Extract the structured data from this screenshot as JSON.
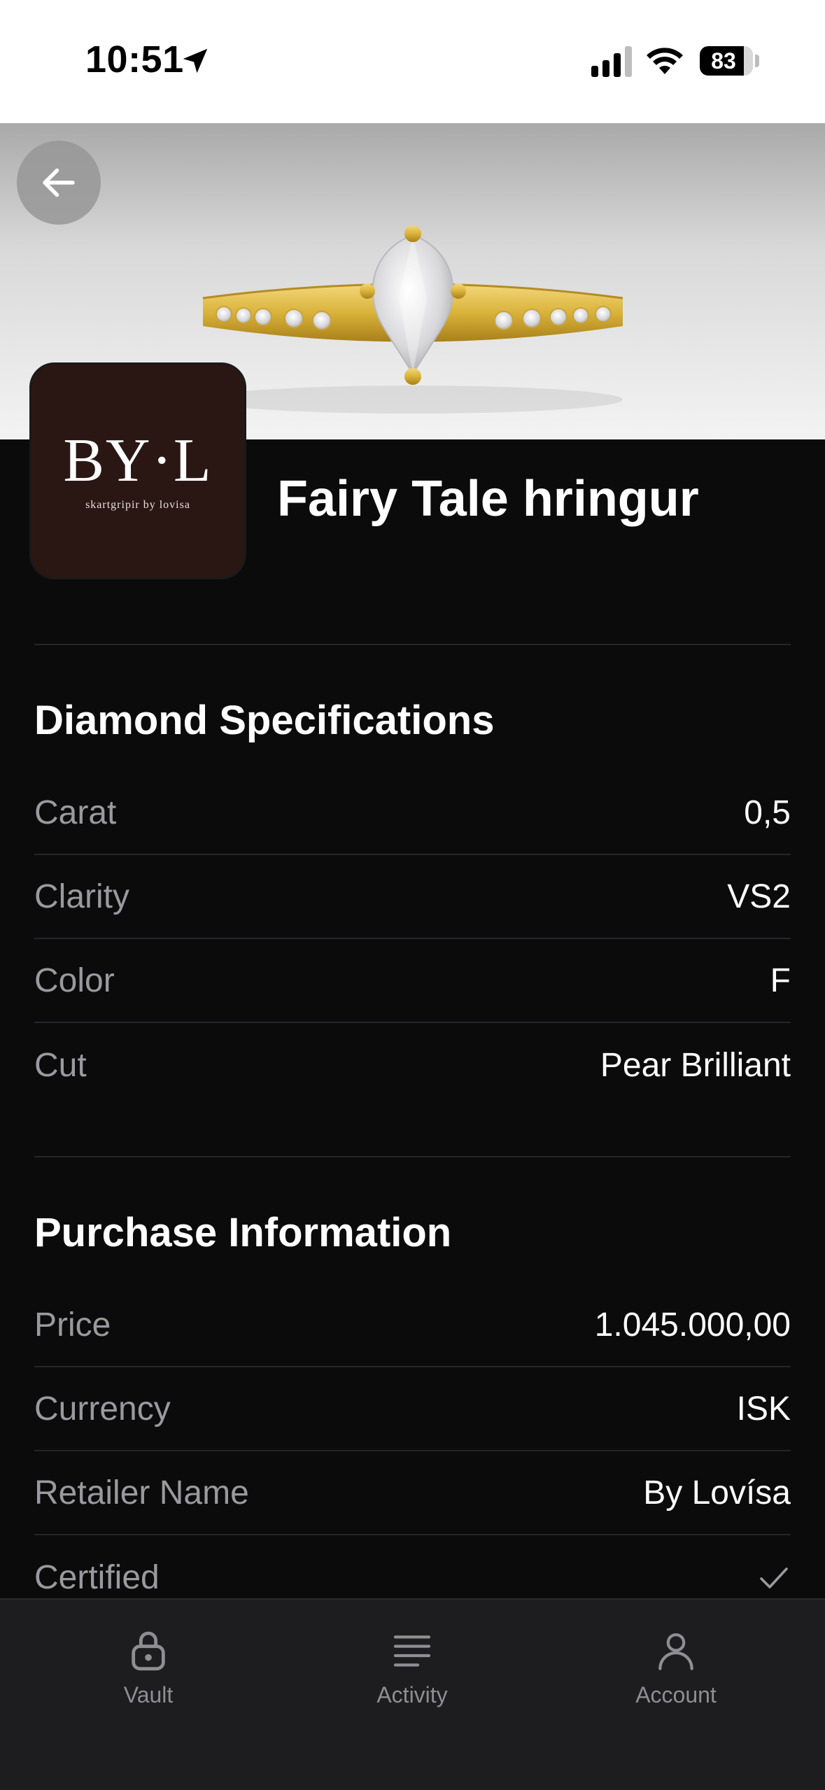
{
  "status_bar": {
    "time": "10:51",
    "battery": "83",
    "battery_level": 0.83
  },
  "product": {
    "title": "Fairy Tale hringur",
    "brand_logo_text": "BY·L",
    "brand_logo_subtitle": "skartgripir by lovisa"
  },
  "diamond_specs": {
    "title": "Diamond Specifications",
    "rows": [
      {
        "label": "Carat",
        "value": "0,5"
      },
      {
        "label": "Clarity",
        "value": "VS2"
      },
      {
        "label": "Color",
        "value": "F"
      },
      {
        "label": "Cut",
        "value": "Pear Brilliant"
      }
    ]
  },
  "purchase_info": {
    "title": "Purchase Information",
    "rows": [
      {
        "label": "Price",
        "value": "1.045.000,00"
      },
      {
        "label": "Currency",
        "value": "ISK"
      },
      {
        "label": "Retailer Name",
        "value": "By Lovísa"
      },
      {
        "label": "Certified",
        "icon": "checkmark-icon"
      }
    ]
  },
  "tab_bar": {
    "tabs": [
      {
        "label": "Vault",
        "icon": "lock-icon"
      },
      {
        "label": "Activity",
        "icon": "list-icon"
      },
      {
        "label": "Account",
        "icon": "person-icon"
      }
    ]
  },
  "colors": {
    "background": "#0b0b0c",
    "tab_bar": "#1d1d1f",
    "label_gray": "#9a9a9e",
    "gold": "#d9b23a"
  }
}
